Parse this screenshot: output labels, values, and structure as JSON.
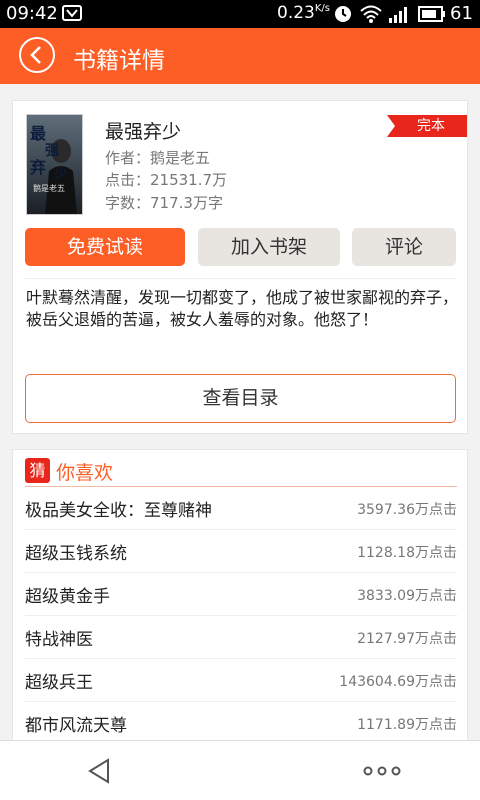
{
  "status_bar": {
    "time": "09:42",
    "network_speed": "0.23",
    "network_unit": "K/s",
    "battery": "61"
  },
  "app_bar": {
    "title": "书籍详情"
  },
  "book": {
    "title": "最强弃少",
    "author": "作者：鹅是老五",
    "clicks": "点击：21531.7万",
    "words": "字数：717.3万字",
    "status": "完本",
    "cover_text": "最强弃少",
    "cover_author": "鹅是老五",
    "description": "叶默蓦然清醒，发现一切都变了，他成了被世家鄙视的弃子，被岳父退婚的苦逼，被女人羞辱的对象。他怒了！"
  },
  "actions": {
    "read_free": "免费试读",
    "add_shelf": "加入书架",
    "comment": "评论",
    "catalog": "查看目录"
  },
  "recommend": {
    "badge": "猜",
    "title": "你喜欢",
    "items": [
      {
        "name": "极品美女全收：至尊赌神",
        "count": "3597.36万点击"
      },
      {
        "name": "超级玉钱系统",
        "count": "1128.18万点击"
      },
      {
        "name": "超级黄金手",
        "count": "3833.09万点击"
      },
      {
        "name": "特战神医",
        "count": "2127.97万点击"
      },
      {
        "name": "超级兵王",
        "count": "143604.69万点击"
      },
      {
        "name": "都市风流天尊",
        "count": "1171.89万点击"
      }
    ]
  },
  "colors": {
    "accent": "#fd5e25",
    "tag_red": "#e8261b"
  }
}
